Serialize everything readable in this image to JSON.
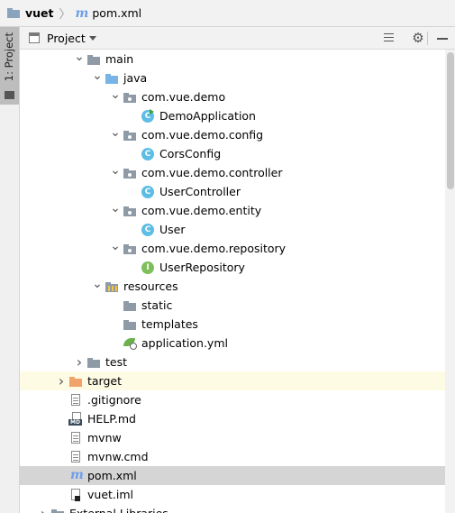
{
  "breadcrumb": {
    "project": "vuet",
    "separator": "〉",
    "file": "pom.xml"
  },
  "side_strip": {
    "tab_label": "1: Project"
  },
  "panel": {
    "title": "Project"
  },
  "tree": [
    {
      "label": "main",
      "indent": 2,
      "arrow": "expanded",
      "icon": "folder-icon",
      "selected": false
    },
    {
      "label": "java",
      "indent": 3,
      "arrow": "expanded",
      "icon": "source-folder-icon"
    },
    {
      "label": "com.vue.demo",
      "indent": 4,
      "arrow": "expanded",
      "icon": "package-icon"
    },
    {
      "label": "DemoApplication",
      "indent": 5,
      "arrow": "none",
      "icon": "spring-boot-class-icon"
    },
    {
      "label": "com.vue.demo.config",
      "indent": 4,
      "arrow": "expanded",
      "icon": "package-icon"
    },
    {
      "label": "CorsConfig",
      "indent": 5,
      "arrow": "none",
      "icon": "class-icon"
    },
    {
      "label": "com.vue.demo.controller",
      "indent": 4,
      "arrow": "expanded",
      "icon": "package-icon"
    },
    {
      "label": "UserController",
      "indent": 5,
      "arrow": "none",
      "icon": "class-icon"
    },
    {
      "label": "com.vue.demo.entity",
      "indent": 4,
      "arrow": "expanded",
      "icon": "package-icon"
    },
    {
      "label": "User",
      "indent": 5,
      "arrow": "none",
      "icon": "class-icon"
    },
    {
      "label": "com.vue.demo.repository",
      "indent": 4,
      "arrow": "expanded",
      "icon": "package-icon"
    },
    {
      "label": "UserRepository",
      "indent": 5,
      "arrow": "none",
      "icon": "interface-icon"
    },
    {
      "label": "resources",
      "indent": 3,
      "arrow": "expanded",
      "icon": "resources-folder-icon"
    },
    {
      "label": "static",
      "indent": 4,
      "arrow": "none",
      "icon": "folder-icon"
    },
    {
      "label": "templates",
      "indent": 4,
      "arrow": "none",
      "icon": "folder-icon"
    },
    {
      "label": "application.yml",
      "indent": 4,
      "arrow": "none",
      "icon": "yaml-file-icon"
    },
    {
      "label": "test",
      "indent": 2,
      "arrow": "collapsed",
      "icon": "folder-icon"
    },
    {
      "label": "target",
      "indent": 1,
      "arrow": "collapsed",
      "icon": "excluded-folder-icon",
      "highlight": "yellow"
    },
    {
      "label": ".gitignore",
      "indent": 1,
      "arrow": "none",
      "icon": "text-file-icon"
    },
    {
      "label": "HELP.md",
      "indent": 1,
      "arrow": "none",
      "icon": "markdown-file-icon"
    },
    {
      "label": "mvnw",
      "indent": 1,
      "arrow": "none",
      "icon": "text-file-icon"
    },
    {
      "label": "mvnw.cmd",
      "indent": 1,
      "arrow": "none",
      "icon": "text-file-icon"
    },
    {
      "label": "pom.xml",
      "indent": 1,
      "arrow": "none",
      "icon": "maven-file-icon",
      "highlight": "selected"
    },
    {
      "label": "vuet.iml",
      "indent": 1,
      "arrow": "none",
      "icon": "iml-file-icon"
    },
    {
      "label": "External Libraries",
      "indent": 0,
      "arrow": "collapsed",
      "icon": "library-icon"
    }
  ]
}
